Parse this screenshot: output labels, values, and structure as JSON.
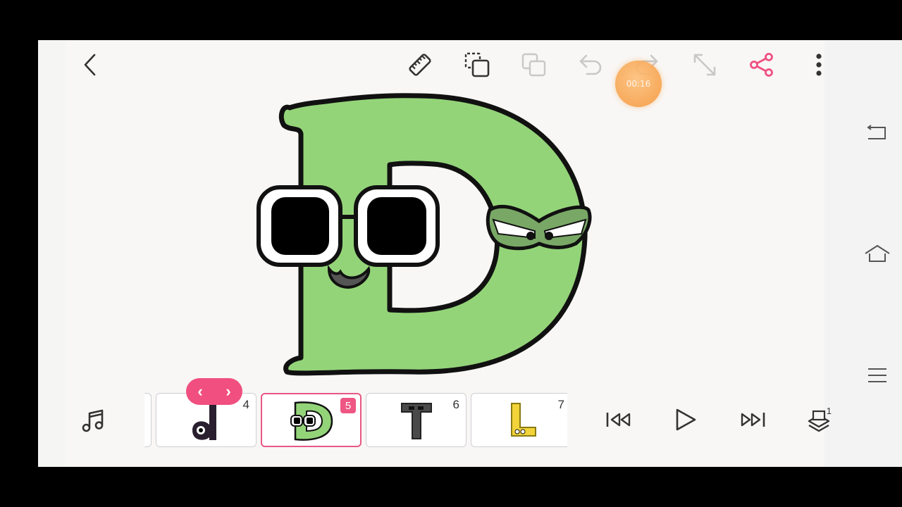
{
  "toolbar": {
    "icons": [
      "back-icon",
      "ruler-icon",
      "paste-frame-icon",
      "duplicate-icon",
      "undo-icon",
      "redo-icon",
      "fullscreen-icon",
      "share-icon",
      "more-icon"
    ],
    "accent_color": "#f04f7f"
  },
  "recording": {
    "time": "00:16",
    "color": "#f7a24c"
  },
  "timeline": {
    "frames": [
      {
        "number": "4",
        "thumb": "lowercase-d"
      },
      {
        "number": "5",
        "thumb": "green-D",
        "selected": true
      },
      {
        "number": "6",
        "thumb": "grey-T"
      },
      {
        "number": "7",
        "thumb": "yellow-L"
      }
    ],
    "prev_symbol": "‹",
    "next_symbol": "›"
  },
  "playback": {
    "icons": [
      "music-icon",
      "skip-back-icon",
      "play-icon",
      "skip-forward-icon",
      "layers-icon"
    ],
    "layers_count": "1"
  },
  "system_nav": {
    "icons": [
      "system-back-icon",
      "home-icon",
      "recents-icon"
    ]
  },
  "drawing": {
    "fill_color": "#94d479",
    "outline_color": "#111111"
  }
}
